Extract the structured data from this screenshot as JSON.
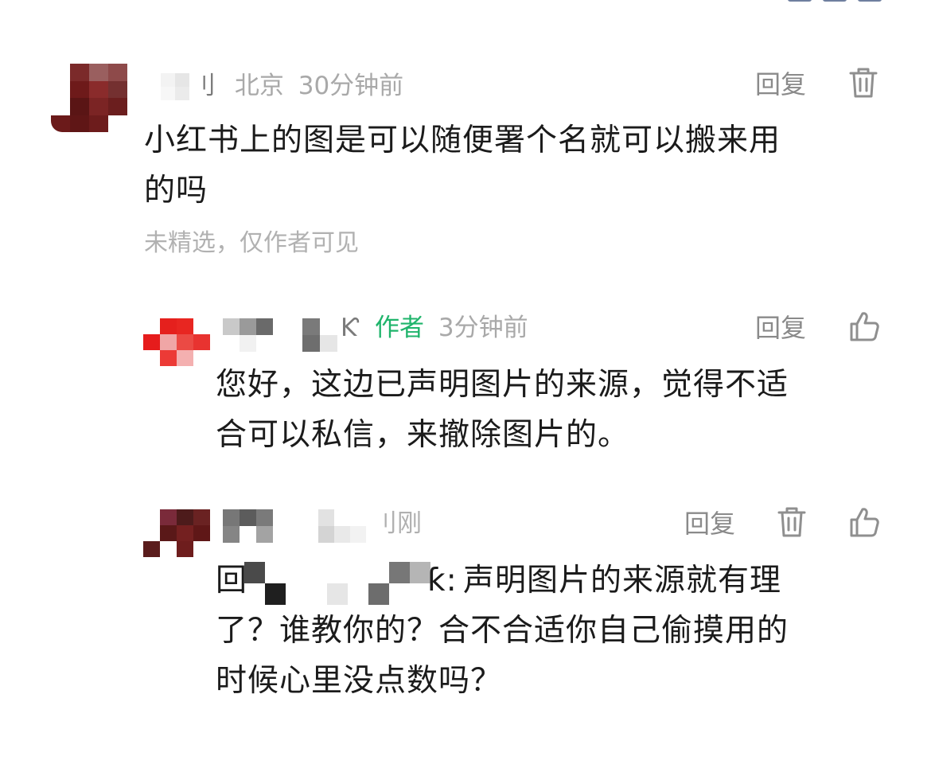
{
  "comments": [
    {
      "name_fragment": "刂",
      "location": "北京",
      "time": "30分钟前",
      "reply_label": "回复",
      "text_line1": "小红书上的图是可以随便署个名就可以搬来用",
      "text_line2": "的吗",
      "status": "未精选，仅作者可见",
      "action_icon": "trash-icon"
    },
    {
      "name_fragment": "Ƙ",
      "author_badge": "作者",
      "time": "3分钟前",
      "reply_label": "回复",
      "text_line1": "您好，这边已声明图片的来源，觉得不适",
      "text_line2": "合可以私信，来撤除图片的。",
      "action_icon": "thumbs-up-icon"
    },
    {
      "time_fragment": "刂刚",
      "reply_label": "回复",
      "reply_prefix": "回",
      "quote_tail": "ƙ:",
      "text_line1": "声明图片的来源就有理",
      "text_line2": "了？谁教你的？合不合适你自己偷摸用的",
      "text_line3": "时候心里没点数吗？",
      "action_icons": [
        "trash-icon",
        "thumbs-up-icon"
      ]
    }
  ]
}
